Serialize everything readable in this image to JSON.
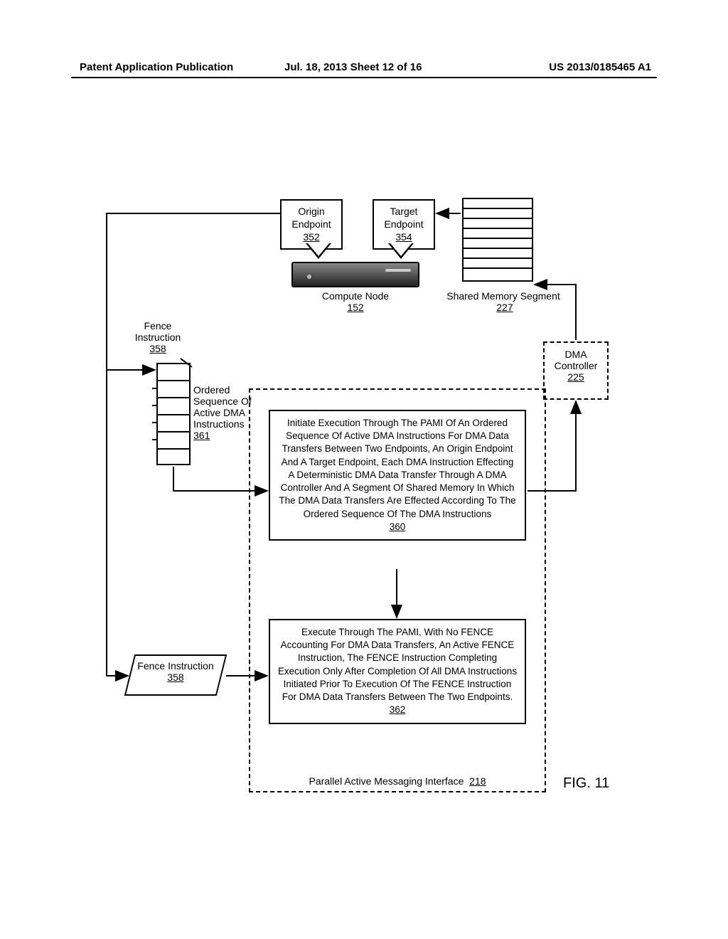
{
  "header": {
    "left": "Patent Application Publication",
    "center": "Jul. 18, 2013  Sheet 12 of 16",
    "right": "US 2013/0185465 A1"
  },
  "origin_endpoint": {
    "label": "Origin Endpoint",
    "ref": "352"
  },
  "target_endpoint": {
    "label": "Target Endpoint",
    "ref": "354"
  },
  "compute_node": {
    "label": "Compute Node",
    "ref": "152"
  },
  "shared_memory": {
    "label": "Shared Memory Segment",
    "ref": "227"
  },
  "dma_controller": {
    "label": "DMA Controller",
    "ref": "225"
  },
  "fence_instruction_top": {
    "label": "Fence Instruction",
    "ref": "358"
  },
  "ordered_sequence": {
    "label": "Ordered Sequence Of Active DMA Instructions",
    "ref": "361"
  },
  "step360": {
    "text": "Initiate Execution Through The PAMI Of An Ordered Sequence Of Active DMA Instructions For DMA Data Transfers Between Two Endpoints, An Origin Endpoint And A Target Endpoint, Each DMA Instruction Effecting A Deterministic DMA Data Transfer Through A DMA Controller And A Segment Of Shared Memory In Which The DMA Data Transfers Are Effected According To The Ordered Sequence Of The DMA Instructions",
    "ref": "360"
  },
  "step362": {
    "text": "Execute Through The PAMI, With No FENCE Accounting For DMA Data Transfers, An Active FENCE Instruction, The FENCE Instruction Completing Execution Only After Completion Of All DMA Instructions Initiated Prior To Execution Of The FENCE Instruction For DMA Data Transfers Between The Two Endpoints.",
    "ref": "362"
  },
  "fence_instruction_input": {
    "label": "Fence Instruction",
    "ref": "358"
  },
  "pami": {
    "label": "Parallel Active Messaging Interface",
    "ref": "218"
  },
  "figure": "FIG. 11"
}
